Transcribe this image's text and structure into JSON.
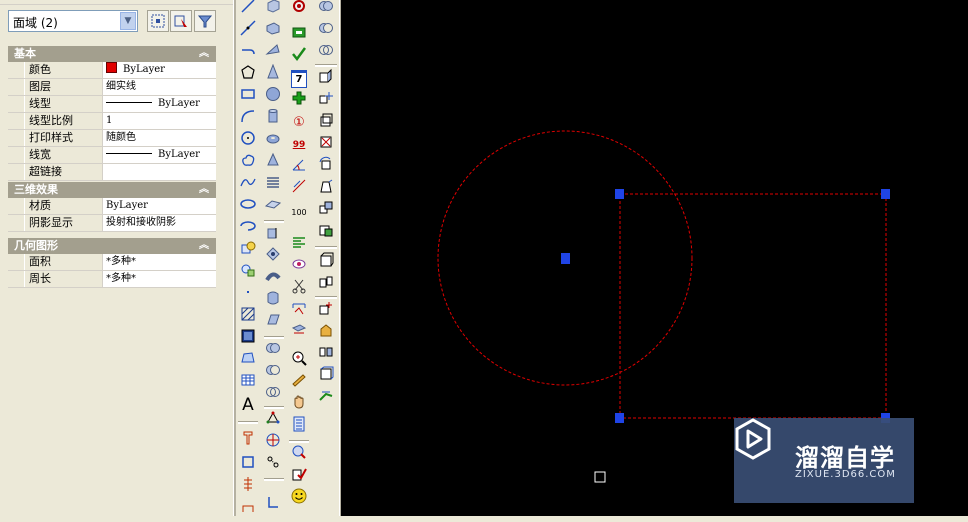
{
  "properties": {
    "selection": "面域 (2)",
    "sections": [
      {
        "title": "基本",
        "rows": [
          {
            "label": "颜色",
            "value": "ByLayer",
            "kind": "color",
            "color": "#e00000"
          },
          {
            "label": "图层",
            "value": "细实线",
            "kind": "text"
          },
          {
            "label": "线型",
            "value": "ByLayer",
            "kind": "linetype"
          },
          {
            "label": "线型比例",
            "value": "1",
            "kind": "text"
          },
          {
            "label": "打印样式",
            "value": "随颜色",
            "kind": "text"
          },
          {
            "label": "线宽",
            "value": "ByLayer",
            "kind": "linetype"
          },
          {
            "label": "超链接",
            "value": "",
            "kind": "text"
          }
        ]
      },
      {
        "title": "三维效果",
        "rows": [
          {
            "label": "材质",
            "value": "ByLayer",
            "kind": "text"
          },
          {
            "label": "阴影显示",
            "value": "投射和接收阴影",
            "kind": "text"
          }
        ]
      },
      {
        "title": "几何图形",
        "rows": [
          {
            "label": "面积",
            "value": "*多种*",
            "kind": "text"
          },
          {
            "label": "周长",
            "value": "*多种*",
            "kind": "text"
          }
        ]
      }
    ]
  },
  "toolbars": {
    "draw": [
      "line-icon",
      "construction-line-icon",
      "polyline-icon",
      "polygon-icon",
      "rectangle-icon",
      "arc-icon",
      "circle-icon",
      "revision-cloud-icon",
      "spline-icon",
      "ellipse-icon",
      "ellipse-arc-icon",
      "insert-block-icon",
      "make-block-icon",
      "point-icon",
      "hatch-icon",
      "gradient-icon",
      "region-icon",
      "table-icon",
      "mtext-icon"
    ],
    "draw_text": {
      "mtext": "A"
    },
    "solids": [
      "box-icon",
      "wedge-icon",
      "cone-icon",
      "sphere-icon",
      "cylinder-icon",
      "torus-icon",
      "pyramid-icon",
      "helix-icon",
      "planar-surface-icon",
      "polysolid-icon",
      "extrude-icon",
      "presspull-icon",
      "sweep-icon",
      "revolve-icon",
      "loft-icon",
      "union-icon",
      "subtract-icon",
      "intersect-icon",
      "3d-orbit-icon",
      "ucs-icon",
      "camera-icon",
      "ucs-world-icon"
    ],
    "misc": [
      "render-icon",
      "group-icon",
      "check-icon",
      "calendar-icon",
      "add-icon",
      "dimension-number-icon",
      "dimension-99-icon",
      "angle-icon",
      "dim-linear-icon",
      "dim-edit-icon",
      "align-text-icon",
      "eye-icon",
      "scissors-icon",
      "measure-icon",
      "layer-icon",
      "zoom-icon",
      "match-properties-icon",
      "pan-icon",
      "calculator-icon",
      "toolpalette-icon",
      "check-mark-icon",
      "smile-icon"
    ],
    "misc_text": {
      "calendar": "7",
      "dim1": "①",
      "dim99": "99",
      "dim100": "100"
    },
    "modify3d": [
      "union-3d-icon",
      "subtract-3d-icon",
      "intersect-3d-icon",
      "extrude-face-icon",
      "move-face-icon",
      "offset-face-icon",
      "delete-face-icon",
      "rotate-face-icon",
      "taper-face-icon",
      "copy-face-icon",
      "color-face-icon",
      "imprint-icon",
      "clean-icon",
      "separate-icon",
      "shell-icon",
      "check-solid-icon",
      "slice-icon",
      "section-icon"
    ]
  },
  "canvas": {
    "background": "#000000",
    "entity_color": "#e00000",
    "grip_color": "#1f44e6",
    "watermark": {
      "cn": "溜溜自学",
      "en": "ZIXUE.3D66.COM"
    }
  }
}
